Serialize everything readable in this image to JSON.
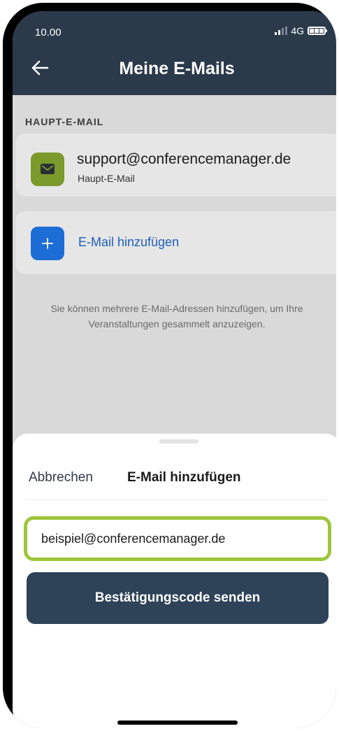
{
  "status_bar": {
    "time": "10.00",
    "network": "4G"
  },
  "header": {
    "title": "Meine E-Mails"
  },
  "main": {
    "section_label": "HAUPT-E-MAIL",
    "primary_email": {
      "address": "support@conferencemanager.de",
      "tag": "Haupt-E-Mail"
    },
    "add_email_label": "E-Mail hinzufügen",
    "hint": "Sie können mehrere E-Mail-Adressen hinzufügen, um Ihre Veranstaltungen gesammelt anzuzeigen."
  },
  "sheet": {
    "cancel_label": "Abbrechen",
    "title": "E-Mail hinzufügen",
    "email_input_value": "beispiel@conferencemanager.de",
    "send_button_label": "Bestätigungscode senden"
  },
  "colors": {
    "header_bg": "#2b3a4b",
    "mail_icon_bg": "#7a9a2c",
    "plus_icon_bg": "#1c6ed6",
    "input_highlight": "#9dc63b",
    "send_button_bg": "#2e4258"
  }
}
